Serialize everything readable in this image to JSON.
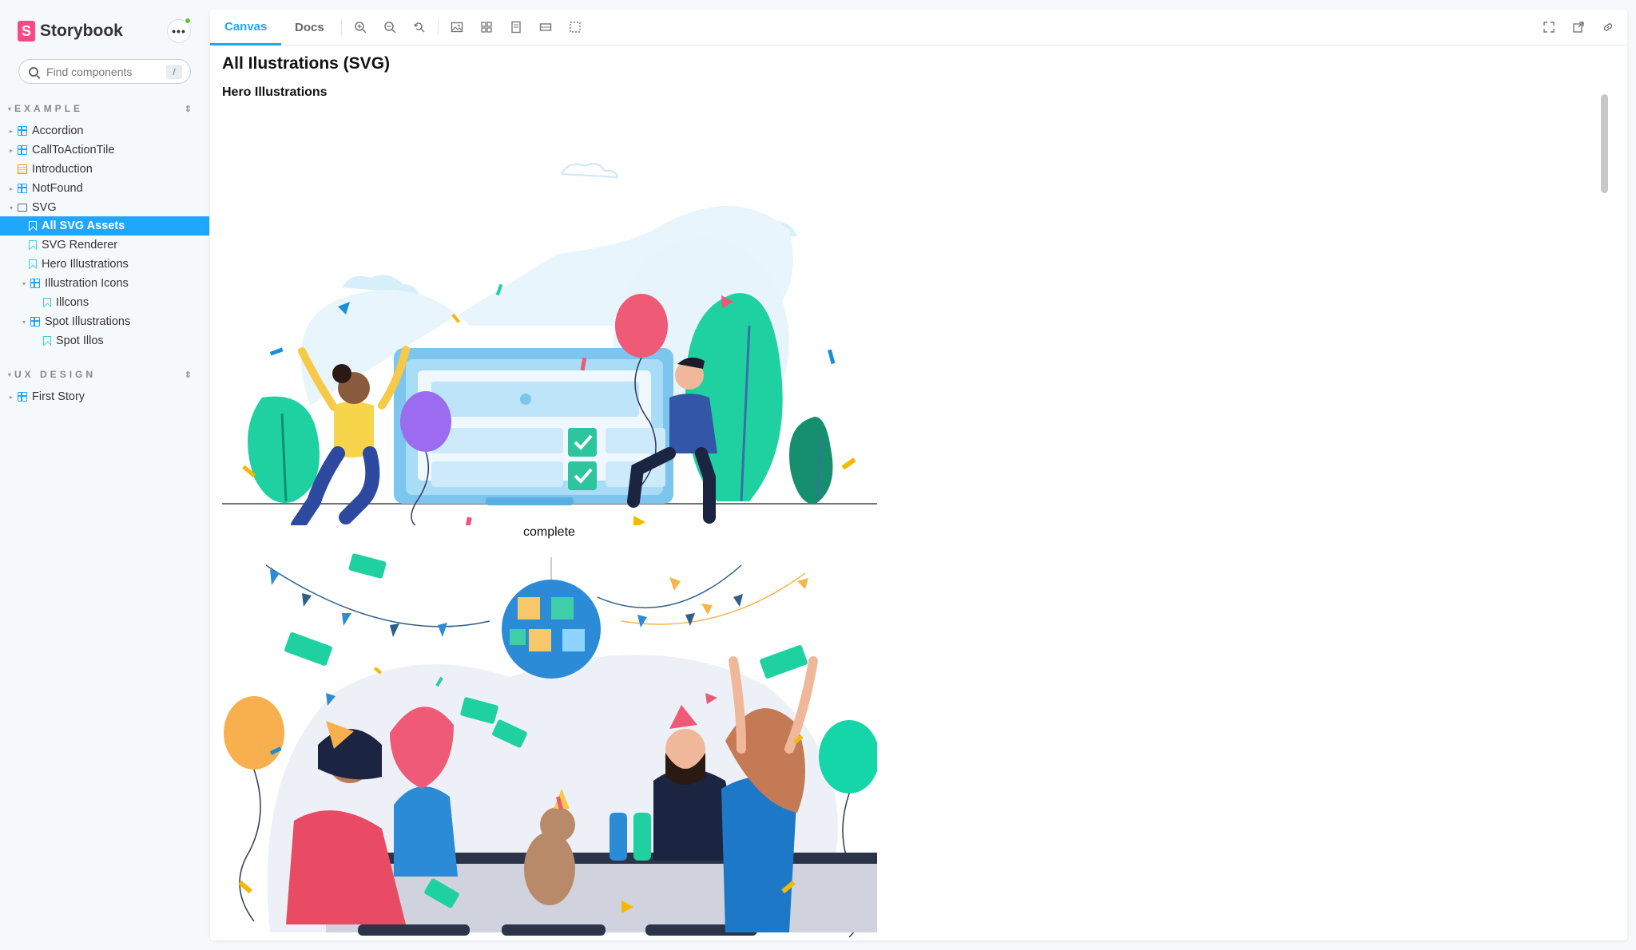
{
  "app": {
    "name": "Storybook",
    "logo_letter": "S"
  },
  "sidebar": {
    "search_placeholder": "Find components",
    "search_shortcut": "/",
    "sections": [
      {
        "title": "EXAMPLE",
        "items": [
          {
            "label": "Accordion",
            "type": "component"
          },
          {
            "label": "CallToActionTile",
            "type": "component"
          },
          {
            "label": "Introduction",
            "type": "doc"
          },
          {
            "label": "NotFound",
            "type": "component"
          },
          {
            "label": "SVG",
            "type": "folder"
          },
          {
            "label": "All SVG Assets",
            "type": "story",
            "selected": true
          },
          {
            "label": "SVG Renderer",
            "type": "story"
          },
          {
            "label": "Hero Illustrations",
            "type": "story"
          },
          {
            "label": "Illustration Icons",
            "type": "component"
          },
          {
            "label": "Illcons",
            "type": "story"
          },
          {
            "label": "Spot Illustrations",
            "type": "component"
          },
          {
            "label": "Spot Illos",
            "type": "story"
          }
        ]
      },
      {
        "title": "UX DESIGN",
        "items": [
          {
            "label": "First Story",
            "type": "component"
          }
        ]
      }
    ]
  },
  "toolbar": {
    "tabs": [
      "Canvas",
      "Docs"
    ],
    "active_tab": "Canvas"
  },
  "canvas": {
    "title": "All Ilustrations (SVG)",
    "subtitle": "Hero Illustrations",
    "illustrations": [
      {
        "caption": "complete"
      }
    ]
  },
  "colors": {
    "accent": "#1ea7fd",
    "brand": "#ff4785",
    "sidebar_bg": "#f6f9fc"
  }
}
